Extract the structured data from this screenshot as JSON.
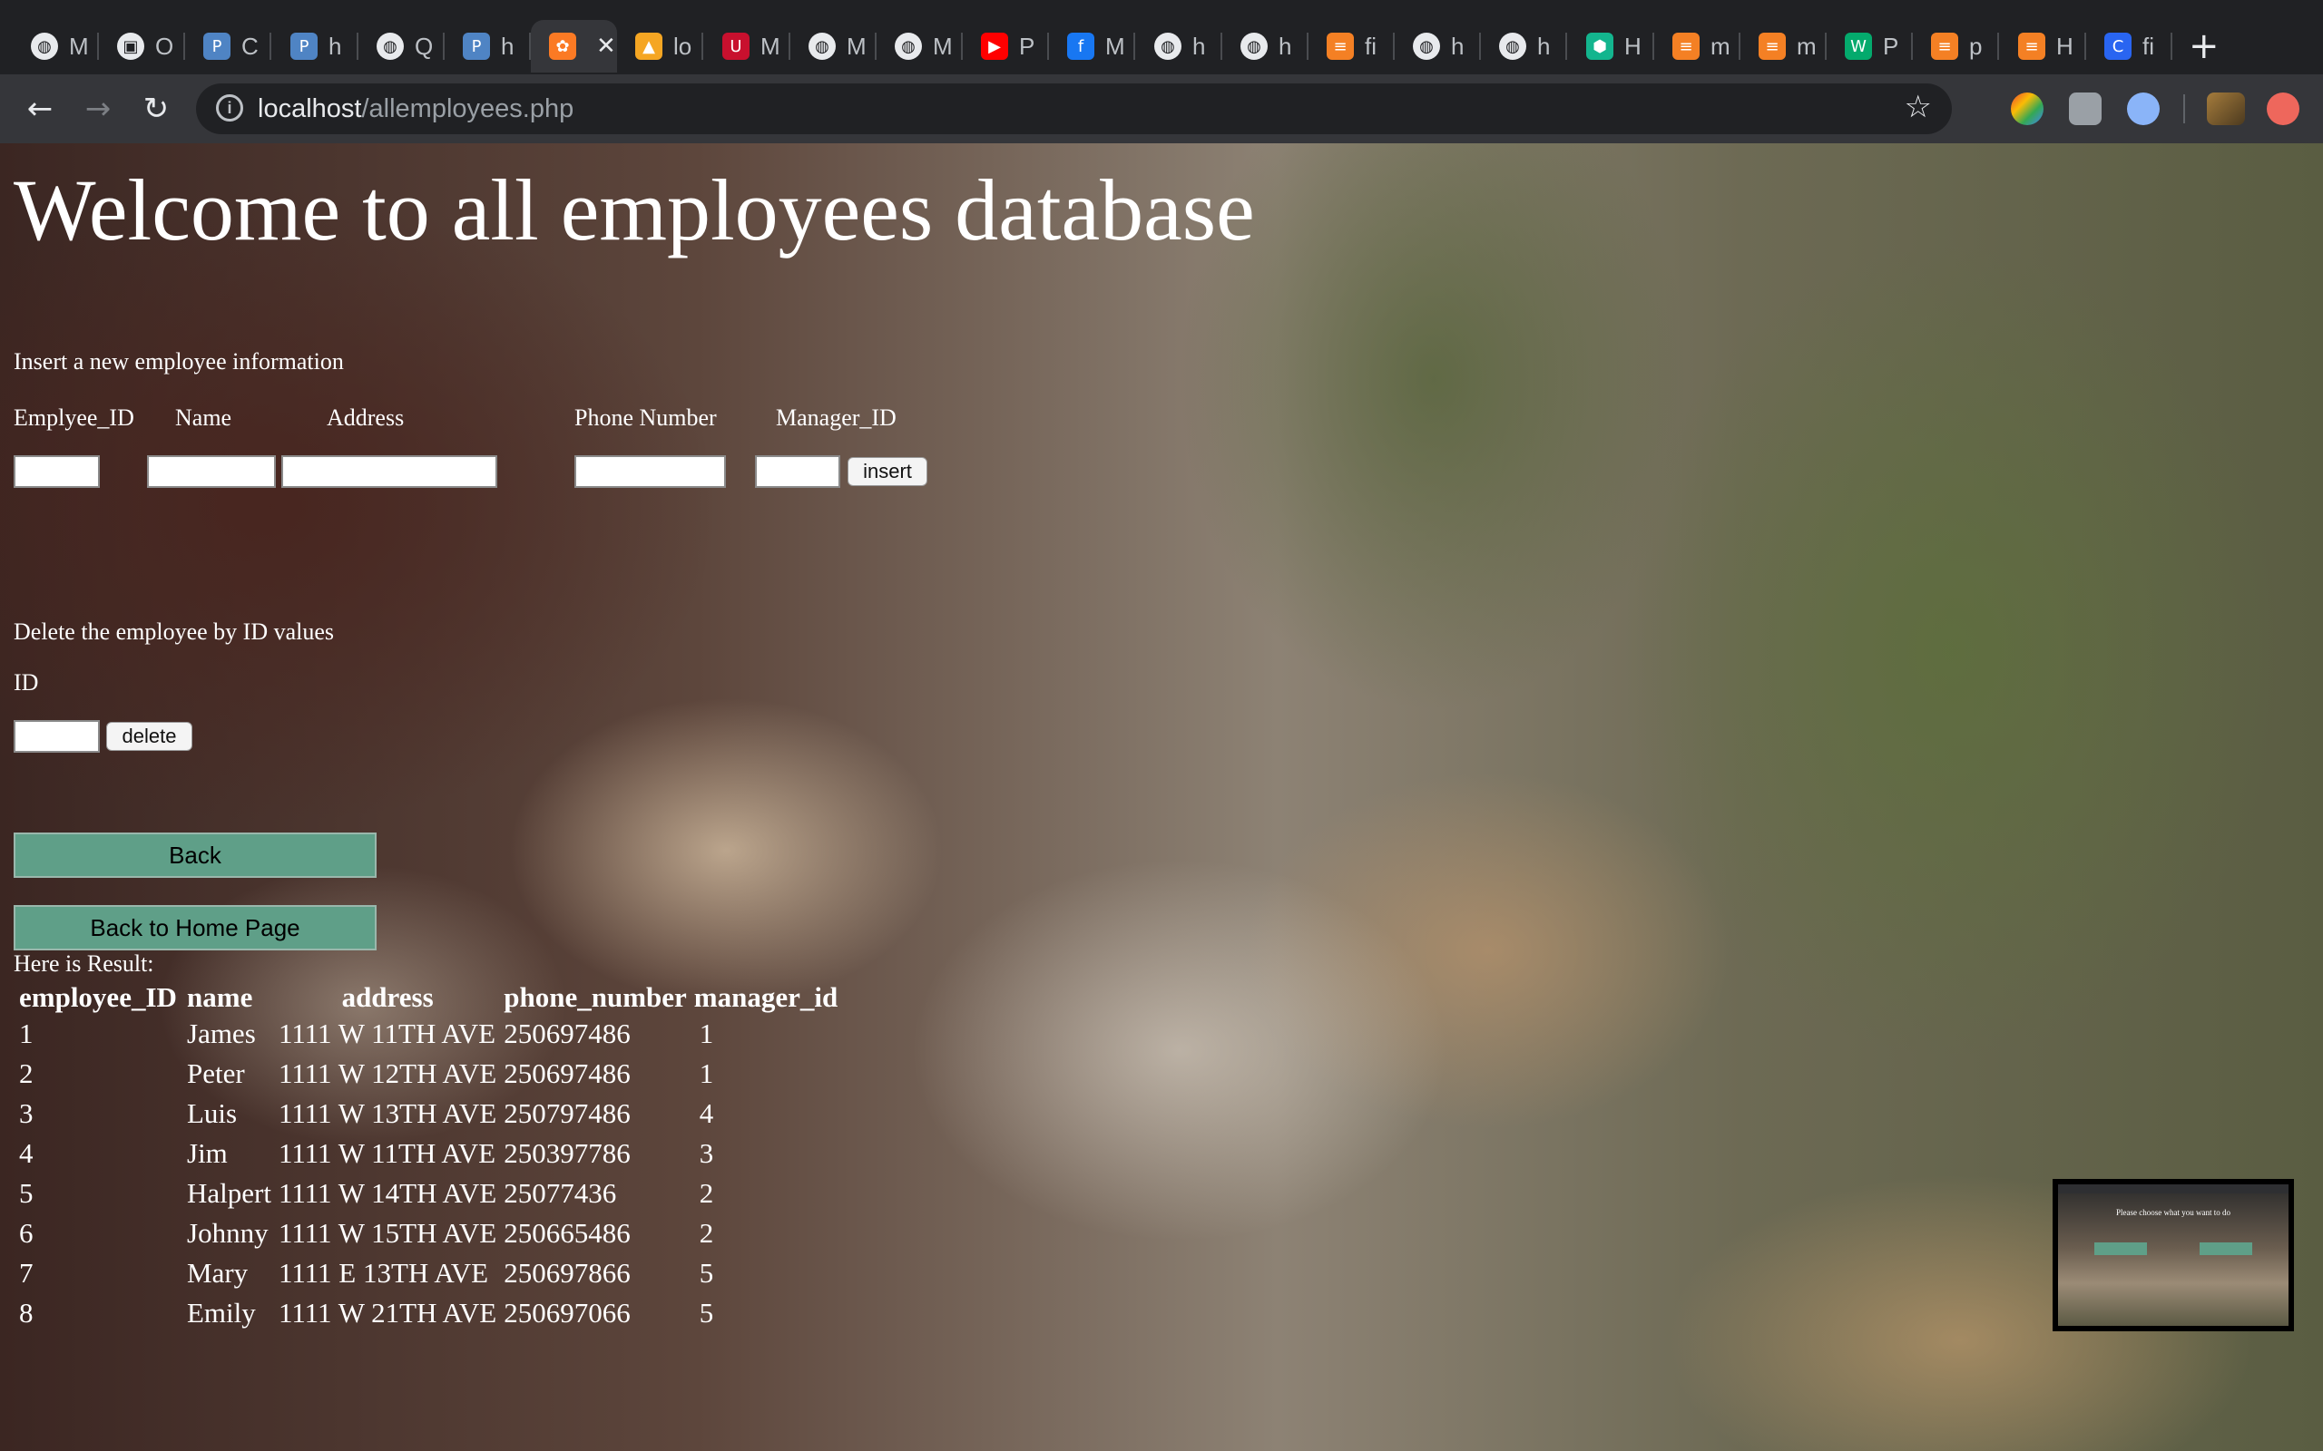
{
  "browser": {
    "tabs": [
      {
        "icon": "globe-icon",
        "title": "M"
      },
      {
        "icon": "company-logo-icon",
        "title": "O"
      },
      {
        "icon": "p-logo-icon",
        "title": "C"
      },
      {
        "icon": "p-logo-icon",
        "title": "h"
      },
      {
        "icon": "globe-icon",
        "title": "Q"
      },
      {
        "icon": "p-logo-icon",
        "title": "h"
      },
      {
        "icon": "xampp-icon",
        "title": "",
        "active": true
      },
      {
        "icon": "phpmyadmin-icon",
        "title": "lo"
      },
      {
        "icon": "ubc-canvas-icon",
        "title": "M"
      },
      {
        "icon": "globe-icon",
        "title": "M"
      },
      {
        "icon": "globe-icon",
        "title": "M"
      },
      {
        "icon": "youtube-icon",
        "title": "P"
      },
      {
        "icon": "facebook-icon",
        "title": "M"
      },
      {
        "icon": "globe-icon",
        "title": "h"
      },
      {
        "icon": "globe-icon",
        "title": "h"
      },
      {
        "icon": "stackoverflow-icon",
        "title": "fi"
      },
      {
        "icon": "globe-icon",
        "title": "h"
      },
      {
        "icon": "globe-icon",
        "title": "h"
      },
      {
        "icon": "hexagon-icon",
        "title": "H"
      },
      {
        "icon": "stackoverflow-icon",
        "title": "m"
      },
      {
        "icon": "stackoverflow-icon",
        "title": "m"
      },
      {
        "icon": "w3schools-icon",
        "title": "P"
      },
      {
        "icon": "stackoverflow-icon",
        "title": "p"
      },
      {
        "icon": "stackoverflow-icon",
        "title": "H"
      },
      {
        "icon": "css-icon",
        "title": "fi"
      }
    ],
    "url_host": "localhost",
    "url_path": "/allemployees.php",
    "close_glyph": "✕",
    "newtab_glyph": "+"
  },
  "page": {
    "title": "Welcome to all employees database",
    "insert": {
      "heading": "Insert a new employee information",
      "labels": {
        "employee_id": "Emplyee_ID",
        "name": "Name",
        "address": "Address",
        "phone": "Phone Number",
        "manager_id": "Manager_ID"
      },
      "button": "insert"
    },
    "delete": {
      "heading": "Delete the employee by ID values",
      "id_label": "ID",
      "button": "delete"
    },
    "back_button": "Back",
    "home_button": "Back to Home Page",
    "result_label": "Here is Result:",
    "table": {
      "headers": [
        "employee_ID",
        "name",
        "address",
        "phone_number",
        "manager_id"
      ],
      "rows": [
        [
          "1",
          "James",
          "1111 W 11TH AVE",
          "250697486",
          "1"
        ],
        [
          "2",
          "Peter",
          "1111 W 12TH AVE",
          "250697486",
          "1"
        ],
        [
          "3",
          "Luis",
          "1111 W 13TH AVE",
          "250797486",
          "4"
        ],
        [
          "4",
          "Jim",
          "1111 W 11TH AVE",
          "250397786",
          "3"
        ],
        [
          "5",
          "Halpert",
          "1111 W 14TH AVE",
          "25077436",
          "2"
        ],
        [
          "6",
          "Johnny",
          "1111 W 15TH AVE",
          "250665486",
          "2"
        ],
        [
          "7",
          "Mary",
          "1111 E 13TH AVE",
          "250697866",
          "5"
        ],
        [
          "8",
          "Emily",
          "1111 W 21TH AVE",
          "250697066",
          "5"
        ]
      ]
    },
    "thumbnail_caption": "Please choose what you want to do"
  }
}
